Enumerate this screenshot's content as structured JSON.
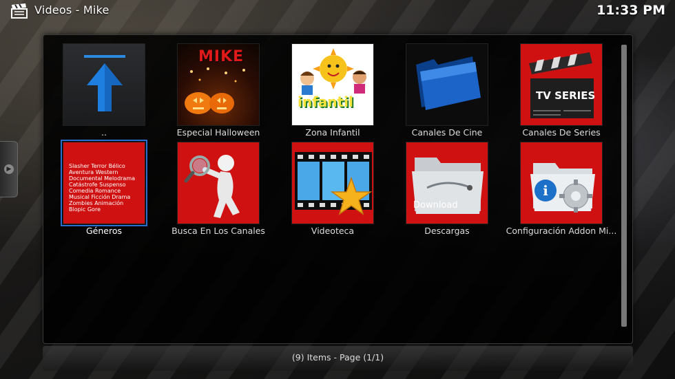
{
  "header": {
    "title": "Videos - Mike",
    "clock": "11:33 PM",
    "icon": "clapperboard-icon"
  },
  "items": [
    {
      "label": "..",
      "thumb": "up-arrow-icon",
      "focused": false
    },
    {
      "label": "Especial Halloween",
      "thumb": "halloween-pumpkins",
      "thumb_text": "MIKE",
      "focused": false
    },
    {
      "label": "Zona Infantil",
      "thumb": "infantil-sun",
      "thumb_text": "infantil",
      "focused": false
    },
    {
      "label": "Canales De Cine",
      "thumb": "blue-folder-icon",
      "focused": false
    },
    {
      "label": "Canales De Series",
      "thumb": "tv-series-clapper",
      "thumb_text": "TV SERIES",
      "focused": false
    },
    {
      "label": "Géneros",
      "thumb": "genre-word-cloud",
      "focused": true,
      "thumb_words": [
        "Slasher",
        "Terror",
        "Bélico",
        "Aventura",
        "Western",
        "Documental",
        "Melodrama",
        "Catástrofe",
        "Suspenso",
        "Comedia",
        "Romance",
        "Musical",
        "Ficción",
        "Drama",
        "Zombies",
        "Animación",
        "Biopic",
        "Gore"
      ]
    },
    {
      "label": "Busca En Los Canales",
      "thumb": "magnifier-figure-icon",
      "focused": false
    },
    {
      "label": "Videoteca",
      "thumb": "film-star-icon",
      "focused": false
    },
    {
      "label": "Descargas",
      "thumb": "download-folder-icon",
      "thumb_text": "Download",
      "focused": false
    },
    {
      "label": "Configuración Addon Mi...",
      "thumb": "settings-folder-icon",
      "focused": false
    }
  ],
  "footer": {
    "status": "(9) Items - Page (1/1)"
  },
  "colors": {
    "tile_red": "#cf1111",
    "focus_blue": "#2a6fcf",
    "panel_bg": "#000000"
  }
}
